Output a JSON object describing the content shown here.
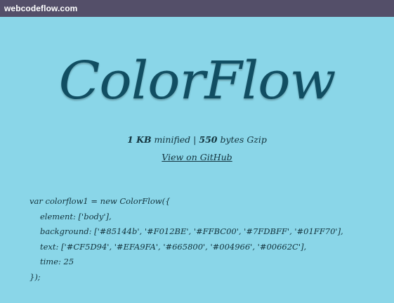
{
  "topbar": {
    "site_name": "webcodeflow.com"
  },
  "hero": {
    "title": "ColorFlow"
  },
  "meta": {
    "size_min": "1 KB",
    "minified": "minified",
    "separator": "|",
    "size_gzip": "550",
    "gzip_label": "bytes Gzip"
  },
  "links": {
    "github": "View on GitHub"
  },
  "code": {
    "lines": [
      "var colorflow1 = new ColorFlow({",
      "element: ['body'],",
      "background: ['#85144b', '#F012BE', '#FFBC00', '#7FDBFF', '#01FF70'],",
      "text: ['#CF5D94', '#EFA9FA', '#665800', '#004966', '#00662C'],",
      "time: 25",
      "});"
    ]
  },
  "colors": {
    "background": "#8ad6e8",
    "topbar": "#544f69",
    "title": "#114e62",
    "text": "#12333d"
  }
}
